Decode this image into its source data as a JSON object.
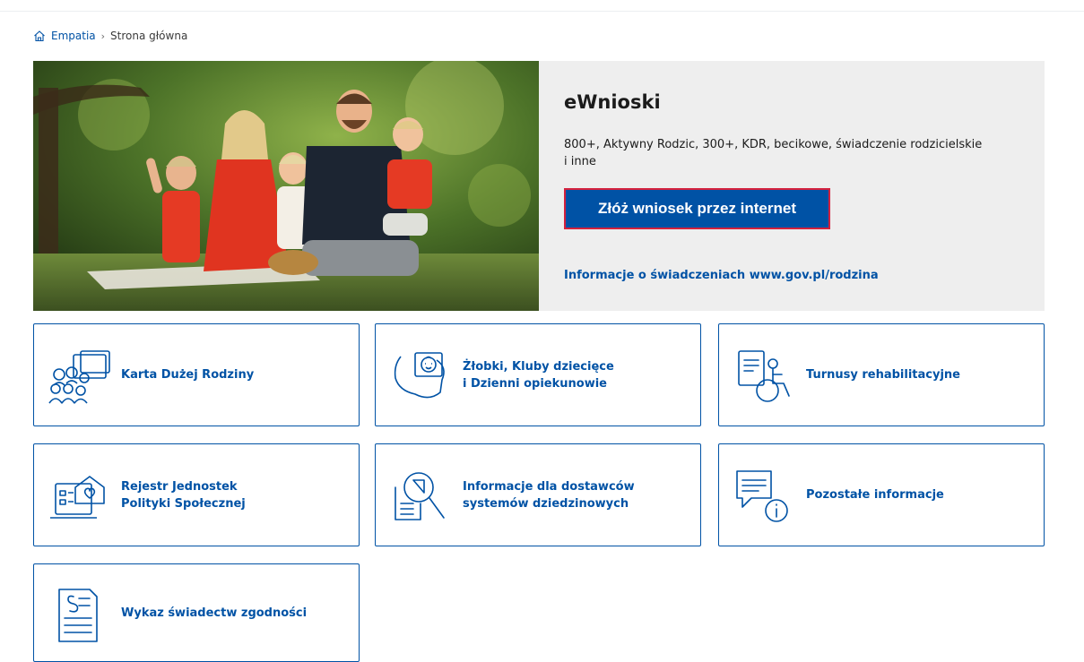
{
  "breadcrumb": {
    "home_icon": "home-icon",
    "root": "Empatia",
    "separator": "›",
    "current": "Strona główna"
  },
  "hero": {
    "photo_alt": "family-picnic-photo",
    "title": "eWnioski",
    "description": "800+, Aktywny Rodzic, 300+, KDR, becikowe, świadczenie rodzicielskie i inne",
    "apply_button": "Złóż wniosek przez internet",
    "info_link": "Informacje o świadczeniach www.gov.pl/rodzina"
  },
  "tiles": [
    {
      "icon": "family-card-icon",
      "line1": "Karta Dużej Rodziny",
      "line2": ""
    },
    {
      "icon": "nursery-map-icon",
      "line1": "Żłobki, Kluby dziecięce",
      "line2": "i Dzienni opiekunowie"
    },
    {
      "icon": "rehab-wheelchair-icon",
      "line1": "Turnusy rehabilitacyjne",
      "line2": ""
    },
    {
      "icon": "social-registry-icon",
      "line1": "Rejestr Jednostek",
      "line2": "Polityki Społecznej"
    },
    {
      "icon": "document-search-icon",
      "line1": "Informacje dla dostawców",
      "line2": "systemów dziedzinowych"
    },
    {
      "icon": "info-message-icon",
      "line1": "Pozostałe informacje",
      "line2": ""
    },
    {
      "icon": "certificate-paragraph-icon",
      "line1": "Wykaz świadectw zgodności",
      "line2": ""
    }
  ],
  "colors": {
    "accent": "#0052a5",
    "button_border": "#d4213d",
    "panel_bg": "#eeeeee"
  }
}
